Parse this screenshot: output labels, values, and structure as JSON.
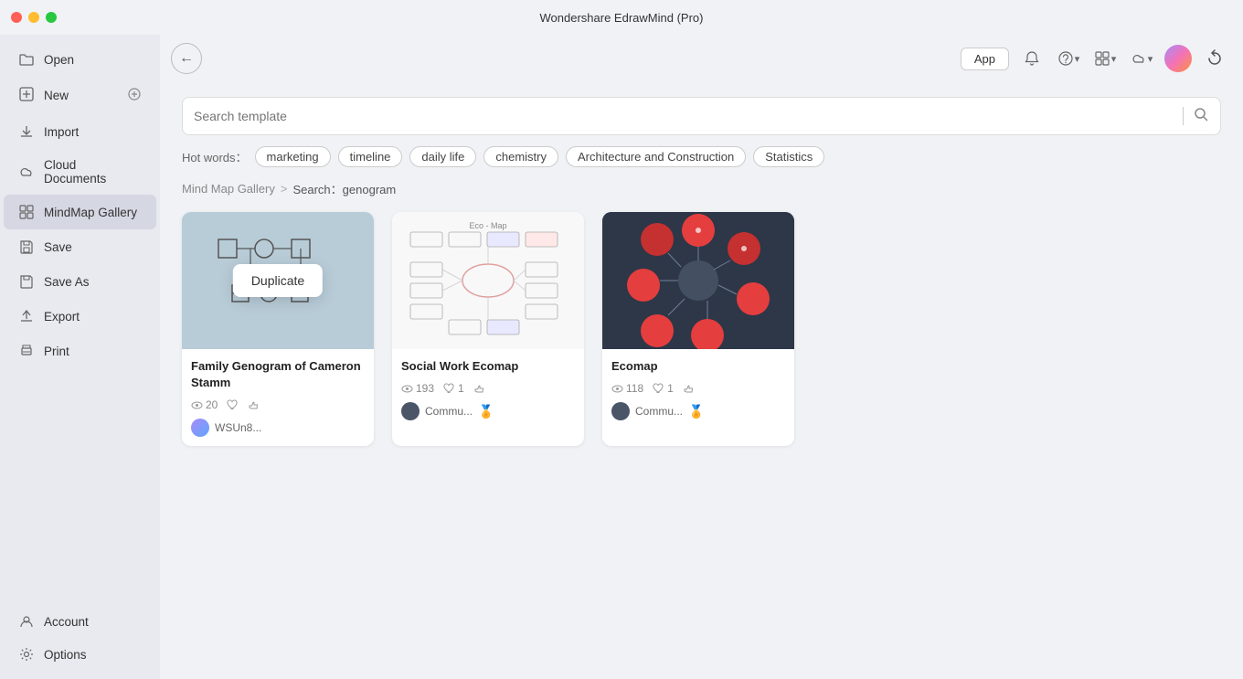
{
  "app": {
    "title": "Wondershare EdrawMind (Pro)"
  },
  "sidebar": {
    "items": [
      {
        "id": "open",
        "label": "Open",
        "icon": "folder-icon"
      },
      {
        "id": "new",
        "label": "New",
        "icon": "plus-icon"
      },
      {
        "id": "import",
        "label": "Import",
        "icon": "import-icon"
      },
      {
        "id": "cloud-documents",
        "label": "Cloud Documents",
        "icon": "cloud-icon"
      },
      {
        "id": "mindmap-gallery",
        "label": "MindMap Gallery",
        "icon": "mindmap-icon"
      },
      {
        "id": "save",
        "label": "Save",
        "icon": "save-icon"
      },
      {
        "id": "save-as",
        "label": "Save As",
        "icon": "saveas-icon"
      },
      {
        "id": "export",
        "label": "Export",
        "icon": "export-icon"
      },
      {
        "id": "print",
        "label": "Print",
        "icon": "print-icon"
      }
    ],
    "bottom_items": [
      {
        "id": "account",
        "label": "Account",
        "icon": "account-icon"
      },
      {
        "id": "options",
        "label": "Options",
        "icon": "options-icon"
      }
    ]
  },
  "topbar": {
    "app_button": "App",
    "refresh_title": "Refresh"
  },
  "search": {
    "placeholder": "Search template",
    "hot_words_label": "Hot words：",
    "tags": [
      "marketing",
      "timeline",
      "daily life",
      "chemistry",
      "Architecture and Construction",
      "Statistics"
    ]
  },
  "breadcrumb": {
    "home": "Mind Map Gallery",
    "separator": ">",
    "search_label": "Search：",
    "query": "genogram"
  },
  "gallery": {
    "cards": [
      {
        "id": "card1",
        "title": "Family Genogram of Cameron Stamm",
        "views": "20",
        "likes": "",
        "thumbs": "",
        "author": "WSUn8...",
        "has_duplicate": true,
        "duplicate_label": "Duplicate"
      },
      {
        "id": "card2",
        "title": "Social Work Ecomap",
        "views": "193",
        "likes": "1",
        "thumbs": "",
        "author": "Commu...",
        "has_gold": true
      },
      {
        "id": "card3",
        "title": "Ecomap",
        "views": "118",
        "likes": "1",
        "thumbs": "",
        "author": "Commu...",
        "has_gold": true
      }
    ]
  }
}
